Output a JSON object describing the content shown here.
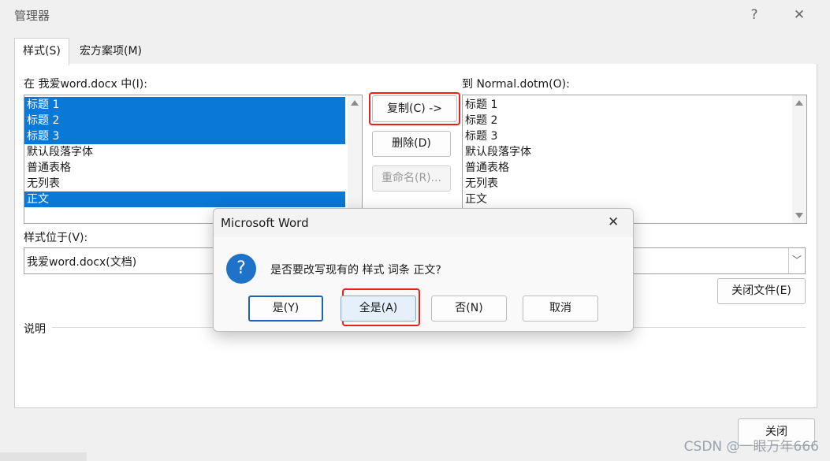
{
  "window": {
    "title": "管理器",
    "help_icon": "?",
    "close_icon": "✕"
  },
  "tabs": [
    {
      "label": "样式(S)",
      "active": true
    },
    {
      "label": "宏方案项(M)",
      "active": false
    }
  ],
  "left": {
    "label": "在 我爱word.docx 中(I):",
    "items": [
      {
        "text": "标题 1",
        "selected": true
      },
      {
        "text": "标题 2",
        "selected": true
      },
      {
        "text": "标题 3",
        "selected": true
      },
      {
        "text": "默认段落字体",
        "selected": false
      },
      {
        "text": "普通表格",
        "selected": false
      },
      {
        "text": "无列表",
        "selected": false
      },
      {
        "text": "正文",
        "selected": true
      }
    ],
    "location_label": "样式位于(V):",
    "location_value": "我爱word.docx(文档)"
  },
  "middle": {
    "copy_label": "复制(C) ->",
    "delete_label": "删除(D)",
    "rename_label": "重命名(R)..."
  },
  "right": {
    "label": "到 Normal.dotm(O):",
    "items": [
      "标题 1",
      "标题 2",
      "标题 3",
      "默认段落字体",
      "普通表格",
      "无列表",
      "正文"
    ],
    "close_file_label": "关闭文件(E)"
  },
  "description_label": "说明",
  "close_label": "关闭",
  "dialog": {
    "title": "Microsoft Word",
    "close_icon": "✕",
    "icon_glyph": "?",
    "message": "是否要改写现有的 样式 词条 正文?",
    "buttons": {
      "yes": "是(Y)",
      "yes_all": "全是(A)",
      "no": "否(N)",
      "cancel": "取消"
    }
  },
  "watermark": "CSDN @一眼万年666",
  "colors": {
    "selection": "#0a78d7",
    "highlight": "#e8221b",
    "question_icon": "#1e73c9"
  }
}
